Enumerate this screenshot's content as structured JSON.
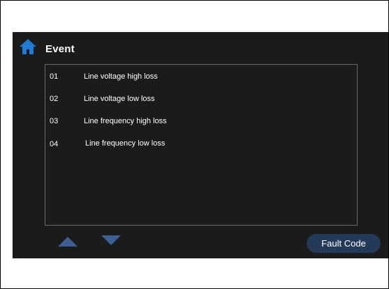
{
  "header": {
    "title": "Event",
    "home_icon": "home-icon",
    "accent_color": "#1e7bd6"
  },
  "event_list": {
    "items": [
      {
        "code": "01",
        "label": "Line voltage high loss"
      },
      {
        "code": "02",
        "label": "Line voltage low loss"
      },
      {
        "code": "03",
        "label": "Line frequency high loss"
      },
      {
        "code": "04",
        "label": "Line frequency low loss"
      }
    ]
  },
  "pager": {
    "up_icon": "triangle-up-icon",
    "down_icon": "triangle-down-icon",
    "arrow_color": "#3b6096"
  },
  "footer": {
    "fault_code_label": "Fault Code",
    "button_color": "#243a59"
  }
}
